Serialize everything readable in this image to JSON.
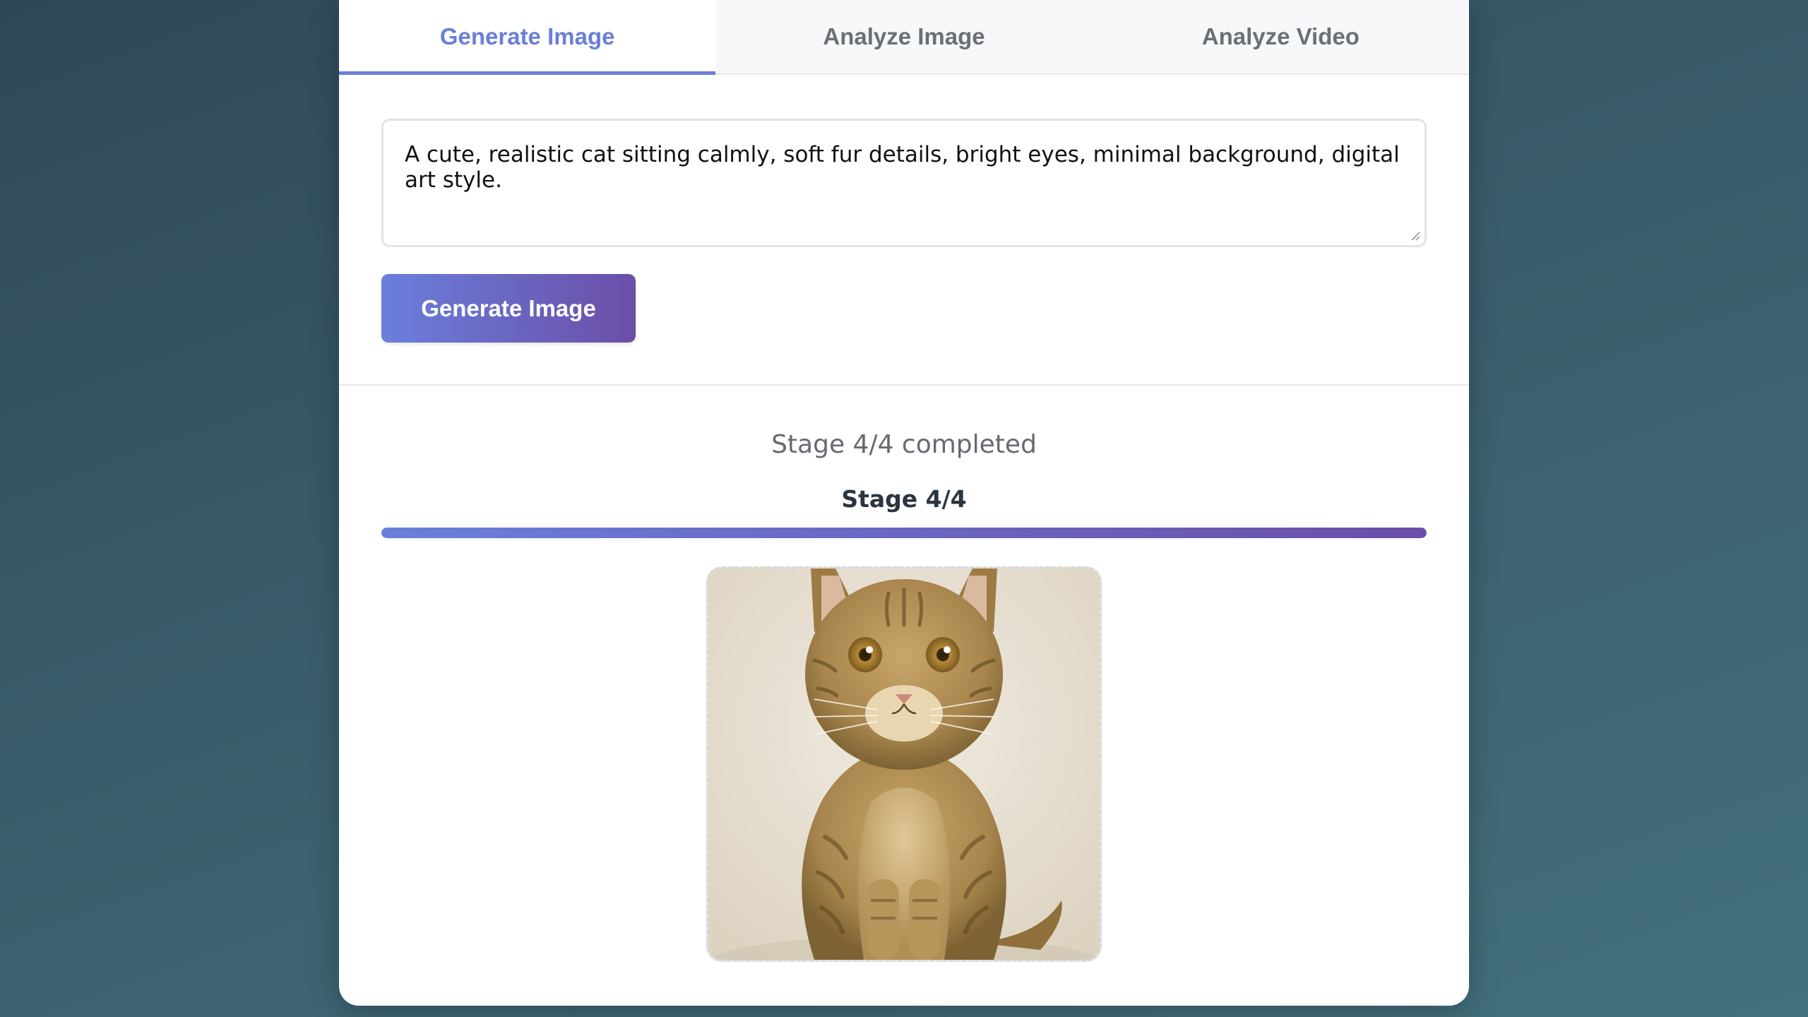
{
  "tabs": [
    {
      "label": "Generate Image",
      "active": true
    },
    {
      "label": "Analyze Image",
      "active": false
    },
    {
      "label": "Analyze Video",
      "active": false
    }
  ],
  "prompt": {
    "value": "A cute, realistic cat sitting calmly, soft fur details, bright eyes, minimal background, digital art style."
  },
  "generate_button": {
    "label": "Generate Image"
  },
  "status": {
    "text": "Stage 4/4 completed",
    "stage_label": "Stage 4/4",
    "progress": 1.0
  },
  "result_image": {
    "subject": "tabby cat sitting facing forward"
  },
  "colors": {
    "accent": "#6b7fd8",
    "gradient_start": "#6a7fdb",
    "gradient_end": "#6b4ea8",
    "page_background": "#2f4858"
  }
}
